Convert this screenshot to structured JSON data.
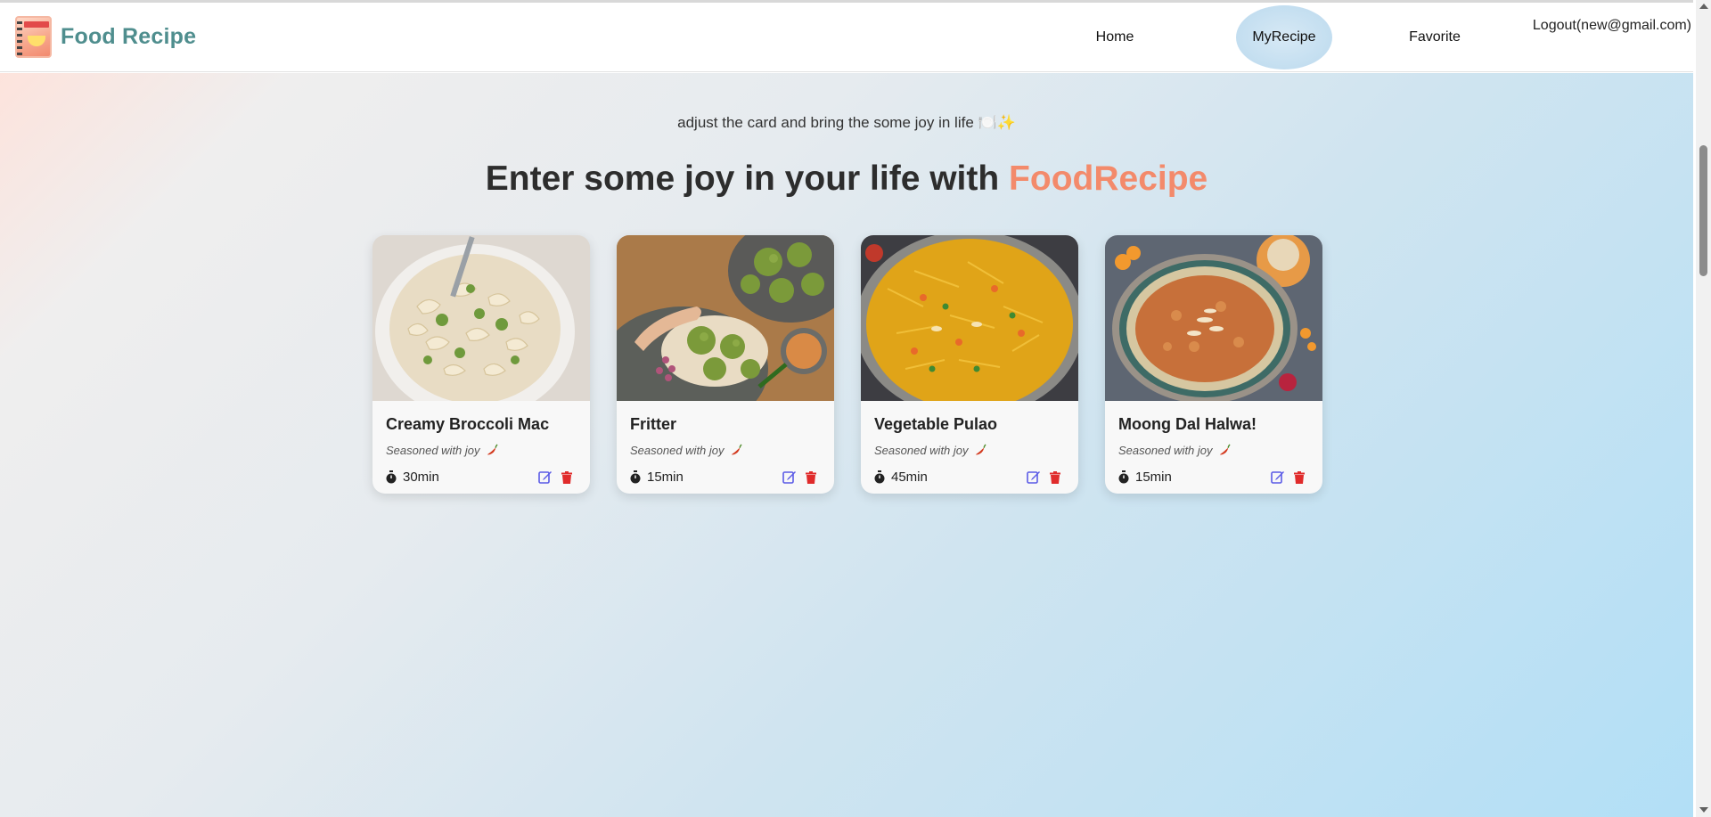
{
  "brand": {
    "name": "Food Recipe",
    "logo_icon": "recipe-book-icon"
  },
  "nav": {
    "home": "Home",
    "my_recipe": "MyRecipe",
    "favorite": "Favorite",
    "logout": "Logout(new@gmail.com)",
    "active": "MyRecipe"
  },
  "hero": {
    "tagline": "adjust the card and bring the some joy in life 🍽️✨",
    "headline_prefix": "Enter some joy in your life with ",
    "headline_brand": "FoodRecipe"
  },
  "colors": {
    "brand_text": "#4f8e8e",
    "accent": "#f38a6b",
    "edit": "#5b5be6",
    "delete": "#e02b2b"
  },
  "cards": [
    {
      "title": "Creamy Broccoli Mac",
      "subtitle": "Seasoned with joy",
      "time": "30min",
      "image": "broccoli-mac-photo"
    },
    {
      "title": "Fritter",
      "subtitle": "Seasoned with joy",
      "time": "15min",
      "image": "fritter-photo"
    },
    {
      "title": "Vegetable Pulao",
      "subtitle": "Seasoned with joy",
      "time": "45min",
      "image": "pulao-photo"
    },
    {
      "title": "Moong Dal Halwa!",
      "subtitle": "Seasoned with joy",
      "time": "15min",
      "image": "halwa-photo"
    }
  ]
}
